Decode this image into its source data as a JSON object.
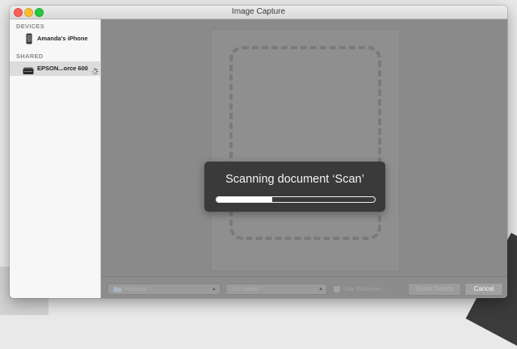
{
  "window": {
    "title": "Image Capture"
  },
  "sidebar": {
    "devices_header": "DEVICES",
    "shared_header": "SHARED",
    "devices": [
      {
        "label": "Amanda's iPhone",
        "icon": "iphone-icon"
      }
    ],
    "shared": [
      {
        "label": "EPSON...orce 600",
        "icon": "scanner-icon",
        "selected": true
      }
    ]
  },
  "bottombar": {
    "folder_value": "Pictures",
    "size_value": "US Letter",
    "use_document_label": "Use Documen...",
    "show_details_label": "Show Details",
    "cancel_label": "Cancel"
  },
  "progress_hud": {
    "message": "Scanning document ‘Scan’",
    "progress": 0.35
  },
  "colors": {
    "close": "#fc5f57",
    "minimize": "#fdbc2e",
    "maximize": "#28c840",
    "hud_background": "#3a3a3a"
  }
}
